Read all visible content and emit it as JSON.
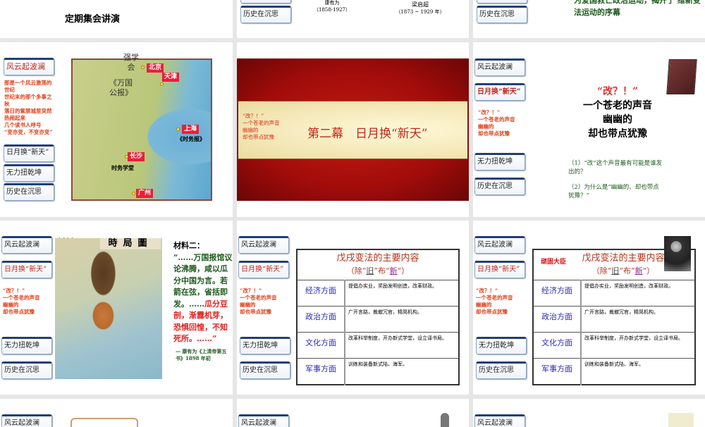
{
  "nav": {
    "b1": "风云起波澜",
    "b2": "日月换“新天”",
    "b3": "无力扭乾坤",
    "b4": "历史在沉思"
  },
  "row0": {
    "s1_title": "定期集会讲演",
    "s2_name1": "康有为",
    "s2_years1": "（1858-1927）",
    "s2_name2": "梁启超",
    "s2_years2": "（1873 ~ 1929 年）",
    "s3_text": "为爱国救亡政治运动，揭开了 维新变法运动的序幕"
  },
  "poem": {
    "l1": "“改？！”",
    "l2": "一个苍老的声音",
    "l3": "幽幽的",
    "l4": "却也带点犹豫"
  },
  "slide1": {
    "intro": [
      "那是一个风云激荡的世纪",
      "世纪末的那个多事之秋",
      "落日的紫禁城里突然热闹起来",
      "几个读书人呼号",
      "“变亦变，不变亦变”"
    ],
    "nav2_wrapped": "日月换“新天”",
    "map": {
      "qxh": "强学会",
      "wggb": "《万国公报》",
      "beijing": "北京",
      "tianjin": "天津",
      "shanghai": "上海",
      "swb": "《时务报》",
      "changsha": "长沙",
      "swxt": "时务学堂",
      "guangzhou": "广州"
    }
  },
  "slide2": {
    "title": "第二幕　日月换“新天”"
  },
  "slide3": {
    "q1": "（1）“改”这个声音最有可能是谁发出的？",
    "q2": "（2）为什么是“幽幽的、却也带点犹豫？”"
  },
  "slide4": {
    "material_label": "材料",
    "cartoon_title": "時局圖",
    "m2_label": "材料二：",
    "m2_green": "“……万国报馆议论沸腾，咸以瓜分中国为言。若箭在弦，省括即发。……",
    "m2_red": "瓜分豆剖，渐露机芽，恐惧回惶，不知死所。……”",
    "source": "— 康有为《上清帝第五书》1898 年初"
  },
  "table": {
    "title": "戊戌变法的主要内容",
    "sub_a": "（除“",
    "sub_old": "旧",
    "sub_b": "”布“",
    "sub_new": "新",
    "sub_c": "”）",
    "rows": [
      {
        "k": "经济方面",
        "v": "提倡办实业，奖励发明创造，改革财政。"
      },
      {
        "k": "政治方面",
        "v": "广开言路，裁撤冗官，精简机构。"
      },
      {
        "k": "文化方面",
        "v": "改革科举制度，开办新式学堂，设立译书局。"
      },
      {
        "k": "军事方面",
        "v": "训练和装备新式陆、海军。"
      }
    ]
  },
  "slide6": {
    "label": "顽固大臣"
  }
}
